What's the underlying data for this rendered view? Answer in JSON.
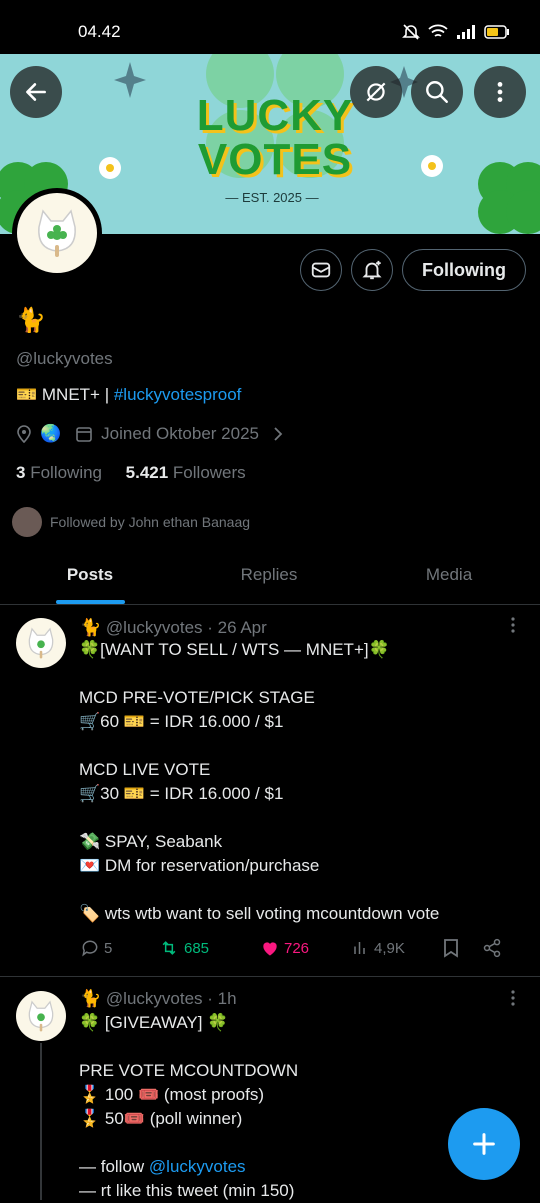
{
  "status": {
    "time": "04.42"
  },
  "banner": {
    "title_line1": "LUCKY",
    "title_line2": "VOTES",
    "est": "— EST. 2025 —"
  },
  "profile": {
    "emoji": "🐈",
    "handle": "@luckyvotes",
    "bio_prefix": "🎫 MNET+ | ",
    "bio_link": "#luckyvotesproof",
    "location_emoji": "🌏",
    "joined": "Joined Oktober 2025",
    "following_count": "3",
    "following_label": "Following",
    "followers_count": "5.421",
    "followers_label": "Followers",
    "followed_by": "Followed by John ethan Banaag",
    "following_button": "Following"
  },
  "tabs": [
    "Posts",
    "Replies",
    "Media"
  ],
  "posts": [
    {
      "emoji": "🐈",
      "handle": "@luckyvotes",
      "time": "· 26 Apr",
      "text": "🍀[WANT TO SELL / WTS — MNET+]🍀\n\nMCD PRE-VOTE/PICK STAGE\n🛒60 🎫 = IDR 16.000 / $1\n\nMCD LIVE VOTE\n🛒30 🎫 = IDR 16.000 / $1\n\n💸 SPAY, Seabank\n💌 DM for reservation/purchase\n\n🏷️ wts wtb want to sell voting mcountdown vote",
      "replies": "5",
      "reposts": "685",
      "likes": "726",
      "views": "4,9K"
    },
    {
      "emoji": "🐈",
      "handle": "@luckyvotes",
      "time": "· 1h",
      "text_line1": "🍀 [GIVEAWAY] 🍀",
      "text_line2": "PRE VOTE MCOUNTDOWN",
      "text_line3": "🎖️ 100 🎟️ (most proofs)",
      "text_line4": "🎖️ 50🎟️ (poll winner)",
      "text_line5_prefix": "— follow ",
      "text_line5_link": "@luckyvotes",
      "text_line6": "— rt like this tweet (min 150)"
    }
  ],
  "colors": {
    "accent": "#1d9bf0",
    "repost": "#00ba7c",
    "like": "#f91880",
    "banner": "#8fd6d8"
  }
}
